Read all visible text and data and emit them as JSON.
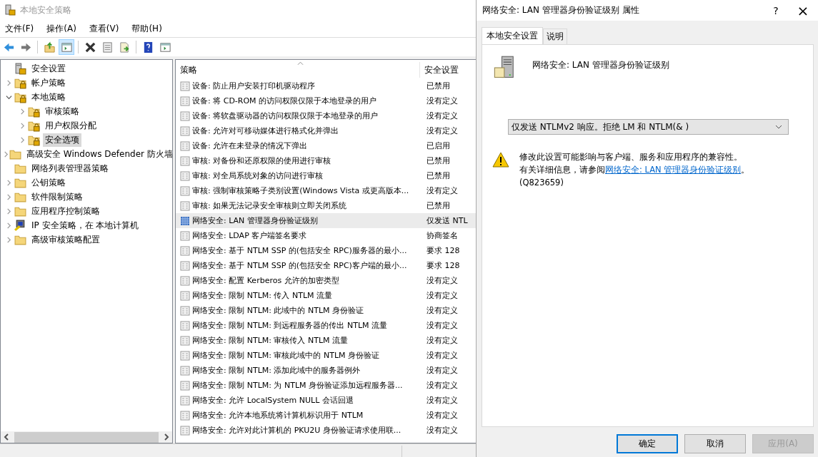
{
  "main_window": {
    "title": "本地安全策略",
    "menu": [
      "文件(F)",
      "操作(A)",
      "查看(V)",
      "帮助(H)"
    ],
    "toolbar": [
      {
        "kind": "back",
        "pressed": false
      },
      {
        "kind": "forward",
        "pressed": false
      },
      {
        "kind": "sep"
      },
      {
        "kind": "up",
        "pressed": false
      },
      {
        "kind": "tree",
        "pressed": true
      },
      {
        "kind": "sep"
      },
      {
        "kind": "delete",
        "pressed": false
      },
      {
        "kind": "properties",
        "pressed": false
      },
      {
        "kind": "export",
        "pressed": false
      },
      {
        "kind": "sep"
      },
      {
        "kind": "help",
        "pressed": false
      },
      {
        "kind": "panel",
        "pressed": false
      }
    ],
    "tree": [
      {
        "label": "安全设置",
        "kind": "root",
        "selected": false,
        "children": [
          {
            "label": "帐户策略",
            "kind": "lock-folder",
            "expanded": false,
            "selected": false
          },
          {
            "label": "本地策略",
            "kind": "lock-folder",
            "expanded": true,
            "selected": false,
            "children": [
              {
                "label": "审核策略",
                "kind": "lock-folder",
                "expanded": false,
                "selected": false
              },
              {
                "label": "用户权限分配",
                "kind": "lock-folder",
                "expanded": false,
                "selected": false
              },
              {
                "label": "安全选项",
                "kind": "lock-folder",
                "expanded": false,
                "selected": true
              }
            ]
          },
          {
            "label": "高级安全 Windows Defender 防火墙",
            "kind": "folder",
            "expanded": false,
            "selected": false
          },
          {
            "label": "网络列表管理器策略",
            "kind": "folder",
            "selected": false
          },
          {
            "label": "公钥策略",
            "kind": "folder",
            "expanded": false,
            "selected": false
          },
          {
            "label": "软件限制策略",
            "kind": "folder",
            "expanded": false,
            "selected": false
          },
          {
            "label": "应用程序控制策略",
            "kind": "folder",
            "expanded": false,
            "selected": false
          },
          {
            "label": "IP 安全策略，在 本地计算机",
            "kind": "ip",
            "expanded": false,
            "selected": false
          },
          {
            "label": "高级审核策略配置",
            "kind": "folder",
            "expanded": false,
            "selected": false
          }
        ]
      }
    ],
    "table": {
      "columns": [
        "策略",
        "安全设置"
      ],
      "rows": [
        {
          "policy": "设备: 防止用户安装打印机驱动程序",
          "setting": "已禁用",
          "selected": false
        },
        {
          "policy": "设备: 将 CD-ROM 的访问权限仅限于本地登录的用户",
          "setting": "没有定义",
          "selected": false
        },
        {
          "policy": "设备: 将软盘驱动器的访问权限仅限于本地登录的用户",
          "setting": "没有定义",
          "selected": false
        },
        {
          "policy": "设备: 允许对可移动媒体进行格式化并弹出",
          "setting": "没有定义",
          "selected": false
        },
        {
          "policy": "设备: 允许在未登录的情况下弹出",
          "setting": "已启用",
          "selected": false
        },
        {
          "policy": "审核: 对备份和还原权限的使用进行审核",
          "setting": "已禁用",
          "selected": false
        },
        {
          "policy": "审核: 对全局系统对象的访问进行审核",
          "setting": "已禁用",
          "selected": false
        },
        {
          "policy": "审核: 强制审核策略子类别设置(Windows Vista 或更高版本...",
          "setting": "没有定义",
          "selected": false
        },
        {
          "policy": "审核: 如果无法记录安全审核则立即关闭系统",
          "setting": "已禁用",
          "selected": false
        },
        {
          "policy": "网络安全: LAN 管理器身份验证级别",
          "setting": "仅发送 NTL",
          "selected": true
        },
        {
          "policy": "网络安全: LDAP 客户端签名要求",
          "setting": "协商签名",
          "selected": false
        },
        {
          "policy": "网络安全: 基于 NTLM SSP 的(包括安全 RPC)服务器的最小...",
          "setting": "要求 128",
          "selected": false
        },
        {
          "policy": "网络安全: 基于 NTLM SSP 的(包括安全 RPC)客户端的最小...",
          "setting": "要求 128",
          "selected": false
        },
        {
          "policy": "网络安全: 配置 Kerberos 允许的加密类型",
          "setting": "没有定义",
          "selected": false
        },
        {
          "policy": "网络安全: 限制 NTLM: 传入 NTLM 流量",
          "setting": "没有定义",
          "selected": false
        },
        {
          "policy": "网络安全: 限制 NTLM: 此域中的 NTLM 身份验证",
          "setting": "没有定义",
          "selected": false
        },
        {
          "policy": "网络安全: 限制 NTLM: 到远程服务器的传出 NTLM 流量",
          "setting": "没有定义",
          "selected": false
        },
        {
          "policy": "网络安全: 限制 NTLM: 审核传入 NTLM 流量",
          "setting": "没有定义",
          "selected": false
        },
        {
          "policy": "网络安全: 限制 NTLM: 审核此域中的 NTLM 身份验证",
          "setting": "没有定义",
          "selected": false
        },
        {
          "policy": "网络安全: 限制 NTLM: 添加此域中的服务器例外",
          "setting": "没有定义",
          "selected": false
        },
        {
          "policy": "网络安全: 限制 NTLM: 为 NTLM 身份验证添加远程服务器...",
          "setting": "没有定义",
          "selected": false
        },
        {
          "policy": "网络安全: 允许 LocalSystem NULL 会话回退",
          "setting": "没有定义",
          "selected": false
        },
        {
          "policy": "网络安全: 允许本地系统将计算机标识用于 NTLM",
          "setting": "没有定义",
          "selected": false
        },
        {
          "policy": "网络安全: 允许对此计算机的 PKU2U 身份验证请求使用联...",
          "setting": "没有定义",
          "selected": false
        }
      ]
    }
  },
  "dialog": {
    "title": "网络安全: LAN 管理器身份验证级别 属性",
    "help": "?",
    "close": "×",
    "tabs": [
      {
        "label": "本地安全设置",
        "selected": true
      },
      {
        "label": "说明",
        "selected": false
      }
    ],
    "policy_name": "网络安全: LAN 管理器身份验证级别",
    "dropdown": {
      "value": "仅发送 NTLMv2 响应。拒绝 LM 和 NTLM(& )"
    },
    "warning": {
      "line1": "修改此设置可能影响与客户端、服务和应用程序的兼容性。",
      "line2_prefix": "有关详细信息，请参阅",
      "link": "网络安全: LAN 管理器身份验证级别",
      "line2_suffix": "。",
      "line3": "(Q823659)"
    },
    "buttons": [
      {
        "label": "确定",
        "default": true,
        "disabled": false
      },
      {
        "label": "取消",
        "default": false,
        "disabled": false
      },
      {
        "label": "应用(A)",
        "default": false,
        "disabled": true
      }
    ]
  }
}
